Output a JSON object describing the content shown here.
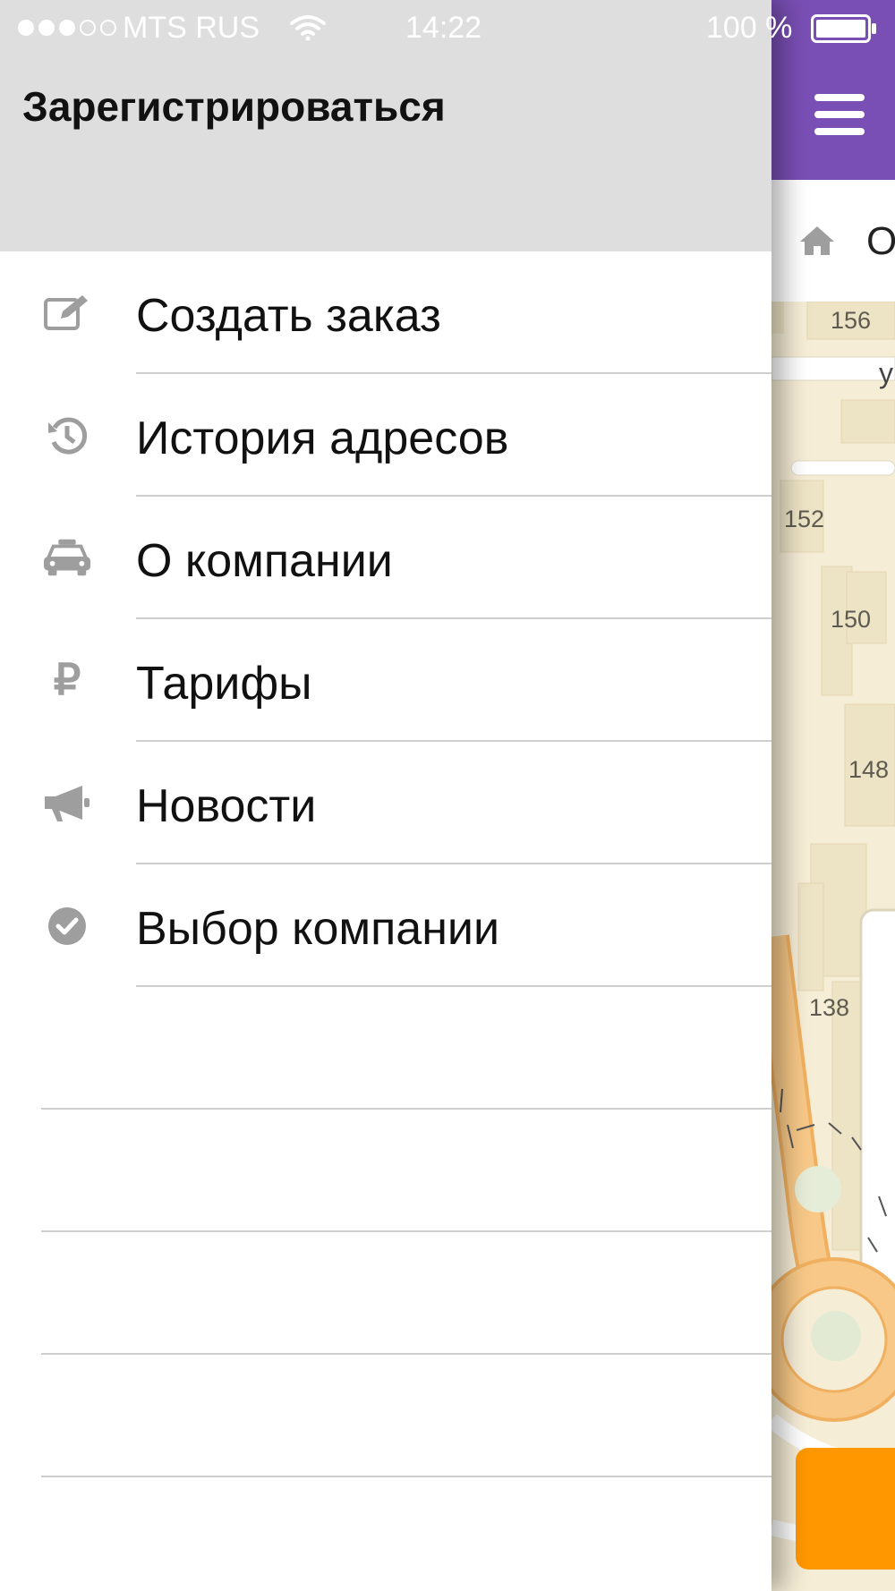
{
  "status_bar": {
    "carrier": "MTS RUS",
    "time": "14:22",
    "battery": "100 %"
  },
  "drawer": {
    "register_label": "Зарегистрироваться",
    "items": [
      {
        "icon": "edit-icon",
        "label": "Создать заказ"
      },
      {
        "icon": "history-icon",
        "label": "История адресов"
      },
      {
        "icon": "taxi-icon",
        "label": "О компании"
      },
      {
        "icon": "ruble-icon",
        "label": "Тарифы",
        "glyph": "₽"
      },
      {
        "icon": "megaphone-icon",
        "label": "Новости"
      },
      {
        "icon": "check-circle-icon",
        "label": "Выбор компании"
      }
    ]
  },
  "app": {
    "address_text": "О",
    "map_labels": [
      "156",
      "152",
      "150",
      "148",
      "138"
    ],
    "street_label": "у"
  },
  "colors": {
    "header_purple": "#7a4fb5",
    "drawer_header": "#dedede",
    "order_button": "#ff9800",
    "map_background": "#f6edd6",
    "icon_gray": "#9e9e9e"
  }
}
